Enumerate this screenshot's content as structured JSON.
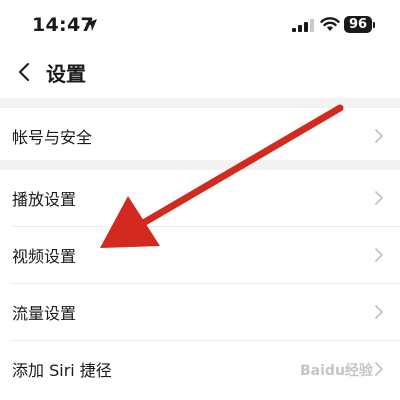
{
  "status_bar": {
    "time": "14:47",
    "battery": "96",
    "icons": [
      "location-arrow-icon",
      "signal-icon",
      "wifi-icon",
      "battery-icon"
    ]
  },
  "nav": {
    "title": "设置",
    "back_icon": "chevron-left-icon"
  },
  "sections": [
    {
      "items": [
        {
          "label": "帐号与安全"
        }
      ]
    },
    {
      "items": [
        {
          "label": "播放设置"
        },
        {
          "label": "视频设置"
        },
        {
          "label": "流量设置"
        },
        {
          "label": "添加 Siri 捷径"
        }
      ]
    }
  ],
  "annotation": {
    "arrow_color": "#d32a20",
    "points_to": "视频设置"
  },
  "watermark": "Baidu经验",
  "colors": {
    "background": "#ffffff",
    "band": "#f2f2f2",
    "chevron": "#c4c4c4",
    "text": "#1a1a1a"
  }
}
